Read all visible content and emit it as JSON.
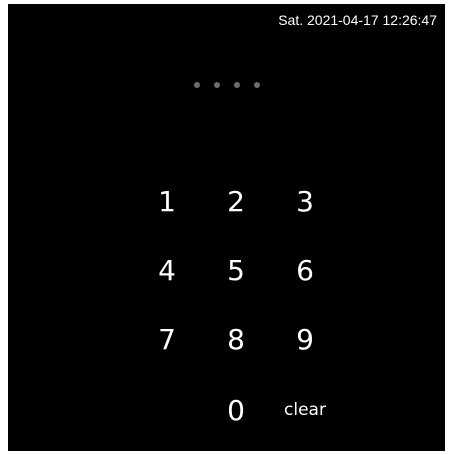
{
  "status": {
    "datetime": "Sat. 2021-04-17 12:26:47"
  },
  "pin": {
    "digits_total": 4,
    "digits_entered": 0,
    "dot_color": "#6e6e6e"
  },
  "keypad": {
    "k1": "1",
    "k2": "2",
    "k3": "3",
    "k4": "4",
    "k5": "5",
    "k6": "6",
    "k7": "7",
    "k8": "8",
    "k9": "9",
    "k0": "0",
    "clear": "clear"
  },
  "colors": {
    "background": "#000000",
    "text": "#ffffff"
  }
}
